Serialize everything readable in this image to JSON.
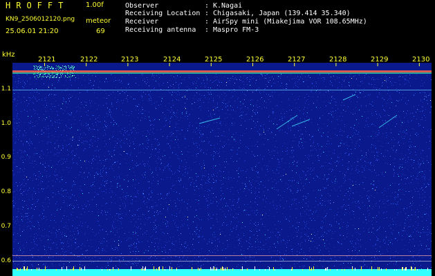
{
  "header": {
    "title": "HROFFT",
    "version": "1.00f",
    "filename": "KN9_2506012120.png",
    "meteor_label": "meteor",
    "datetime": "25.06.01 21:20",
    "meteor_count": "69"
  },
  "info": [
    {
      "label": "Observer",
      "value": "K.Nagai"
    },
    {
      "label": "Receiving Location",
      "value": "Chigasaki, Japan (139.414 35.340)"
    },
    {
      "label": "Receiver",
      "value": "AirSpy mini (Miakejima VOR 108.65MHz)"
    },
    {
      "label": "Receiving antenna",
      "value": "Maspro FM-3"
    }
  ],
  "axis": {
    "unit": "kHz",
    "y_ticks": [
      "1.1",
      "1.0",
      "0.9",
      "0.8",
      "0.7",
      "0.6"
    ],
    "x_ticks": [
      "2121",
      "2122",
      "2123",
      "2124",
      "2125",
      "2126",
      "2127",
      "2128",
      "2129",
      "2130"
    ]
  },
  "colors": {
    "background": "#000000",
    "label_yellow": "#ffff33",
    "spectrogram_base": "#0a1a8c",
    "carrier_line": "#ff5533",
    "bottom_band": "#33ffff"
  }
}
